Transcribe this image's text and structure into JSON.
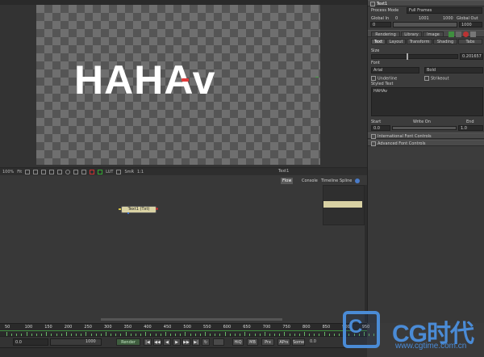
{
  "viewer": {
    "canvas_text": "HAHAv",
    "toolbar_zoom": "100%",
    "toolbar_fit": "Fit",
    "toolbar_label": "Text1",
    "toolbar_lut": "LUT",
    "toolbar_sub": "SmR",
    "toolbar_ratio": "1:1"
  },
  "panel": {
    "title": "Text1",
    "process_mode_label": "Process Mode",
    "process_mode_value": "Full Frames",
    "global_in_label": "Global In",
    "global_in_value": "0",
    "global_in_field": "0",
    "global_mid": "1001",
    "global_out_mid": "1000",
    "global_out_label": "Global Out",
    "global_out_value": "1000",
    "top_tabs": [
      "Rendering",
      "Library",
      "Image"
    ],
    "sub_tabs": [
      "Text",
      "Layout",
      "Transform",
      "Shading",
      "Tabs"
    ],
    "size_label": "Size",
    "size_value": "0.201657",
    "font_label": "Font",
    "font_value": "Arial",
    "style_value": "Bold",
    "underline_label": "Underline",
    "strikeout_label": "Strikeout",
    "styled_text_label": "Styled Text",
    "styled_text_value": "HAHAv",
    "start_label": "Start",
    "writeon_label": "Write On",
    "end_label": "End",
    "start_value": "0.0",
    "end_value": "1.0",
    "intl_label": "International Font Controls",
    "advanced_label": "Advanced Font Controls"
  },
  "flow": {
    "tabs": [
      "Flow",
      "Console",
      "Timeline",
      "Spline"
    ],
    "node_label": "Text1 (Txt)"
  },
  "timeline": {
    "ticks": [
      "50",
      "100",
      "150",
      "200",
      "250",
      "300",
      "350",
      "400",
      "450",
      "500",
      "550",
      "600",
      "650",
      "700",
      "750",
      "800",
      "850",
      "900",
      "950"
    ],
    "start_field": "0.0",
    "end_field": "1000",
    "render_label": "Render",
    "hiq_label": "HiQ",
    "mb_label": "MB",
    "prx_label": "Prx",
    "aprx_label": "APrx",
    "some_label": "Some",
    "current": "0.0"
  },
  "watermark": {
    "letter": "C",
    "brand": "CG时代",
    "url": "www.cgtime.com.cn"
  }
}
